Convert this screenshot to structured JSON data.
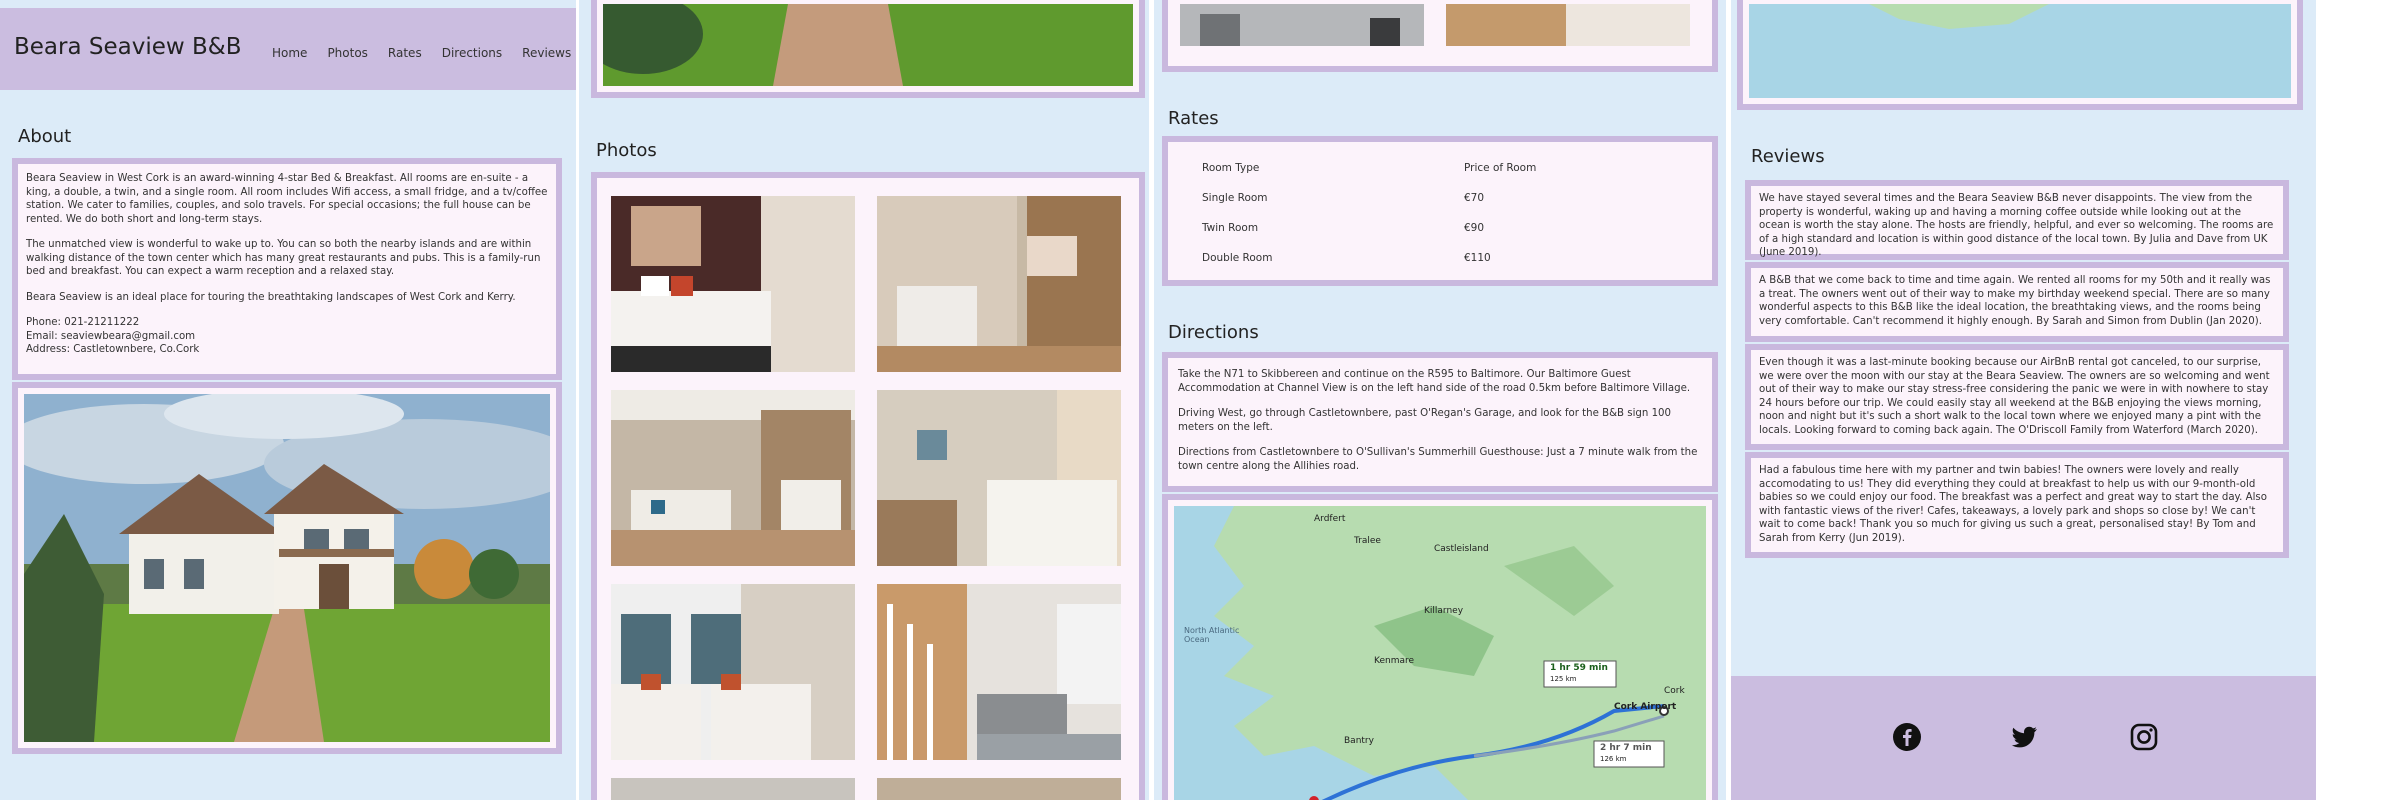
{
  "site": {
    "title": "Beara Seaview B&B"
  },
  "nav": {
    "items": [
      "Home",
      "Photos",
      "Rates",
      "Directions",
      "Reviews"
    ]
  },
  "about": {
    "heading": "About",
    "paragraphs": [
      "Beara Seaview in West Cork is an award-winning 4-star Bed & Breakfast. All rooms are en-suite - a king, a double, a twin, and a single room. All room includes Wifi access, a small fridge, and a tv/coffee station. We cater to families, couples, and solo travels. For special occasions; the full house can be rented. We do both short and long-term stays.",
      "The unmatched view is wonderful to wake up to. You can so both the nearby islands and are within walking distance of the town center which has many great restaurants and pubs. This is a family-run bed and breakfast. You can expect a warm reception and a relaxed stay.",
      "Beara Seaview is an ideal place for touring the breathtaking landscapes of West Cork and Kerry."
    ],
    "phone": "Phone: 021-21211222",
    "email": "Email: seaviewbeara@gmail.com",
    "address": "Address: Castletownbere, Co.Cork"
  },
  "photos": {
    "heading": "Photos"
  },
  "rates": {
    "heading": "Rates",
    "col_type": "Room Type",
    "col_price": "Price of Room",
    "rows": [
      {
        "type": "Single Room",
        "price": "€70"
      },
      {
        "type": "Twin Room",
        "price": "€90"
      },
      {
        "type": "Double Room",
        "price": "€110"
      }
    ]
  },
  "directions": {
    "heading": "Directions",
    "paragraphs": [
      "Take the N71 to Skibbereen and continue on the R595 to Baltimore. Our Baltimore Guest Accommodation at Channel View is on the left hand side of the road 0.5km before Baltimore Village.",
      "Driving West, go through Castletownbere, past O'Regan's Garage, and look for the B&B sign 100 meters on the left.",
      "Directions from Castletownbere to O'Sullivan's Summerhill Guesthouse: Just a 7 minute walk from the town centre along the Allihies road."
    ],
    "map": {
      "labels": [
        "Ardfert",
        "Tralee",
        "Castleisland",
        "Killarney",
        "Cork",
        "Cork Airport",
        "North Atlantic Ocean",
        "Kenmare",
        "Bantry"
      ],
      "route1_time": "1 hr 59 min",
      "route1_dist": "125 km",
      "route2_time": "2 hr 7 min",
      "route2_dist": "126 km"
    }
  },
  "reviews": {
    "heading": "Reviews",
    "items": [
      "We have stayed several times and the Beara Seaview B&B never disappoints. The view from the property is wonderful, waking up and having a morning coffee outside while looking out at the ocean is worth the stay alone. The hosts are friendly, helpful, and ever so welcoming. The rooms are of a high standard and location is within good distance of the local town. By Julia and Dave from UK (June 2019).",
      "A B&B that we come back to time and time again. We rented all rooms for my 50th and it really was a treat. The owners went out of their way to make my birthday weekend special. There are so many wonderful aspects to this B&B like the ideal location, the breathtaking views, and the rooms being very comfortable. Can't recommend it highly enough. By Sarah and Simon from Dublin (Jan 2020).",
      "Even though it was a last-minute booking because our AirBnB rental got canceled, to our surprise, we were over the moon with our stay at the Beara Seaview. The owners are so welcoming and went out of their way to make our stay stress-free considering the panic we were in with nowhere to stay 24 hours before our trip. We could easily stay all weekend at the B&B enjoying the views morning, noon and night but it's such a short walk to the local town where we enjoyed many a pint with the locals. Looking forward to coming back again. The O'Driscoll Family from Waterford (March 2020).",
      "Had a fabulous time here with my partner and twin babies! The owners were lovely and really accomodating to us! They did everything they could at breakfast to help us with our 9-month-old babies so we could enjoy our food. The breakfast was a perfect and great way to start the day. Also with fantastic views of the river! Cafes, takeaways, a lovely park and shops so close by! We can't wait to come back! Thank you so much for giving us such a great, personalised stay! By Tom and Sarah from Kerry (Jun 2019)."
    ]
  },
  "social": {
    "icons": [
      "facebook-icon",
      "twitter-icon",
      "instagram-icon"
    ]
  },
  "colors": {
    "panel_bg": "#dcebf8",
    "accent": "#cbbde0",
    "box_bg": "#fcf3fb",
    "border": "#c9b8de"
  }
}
